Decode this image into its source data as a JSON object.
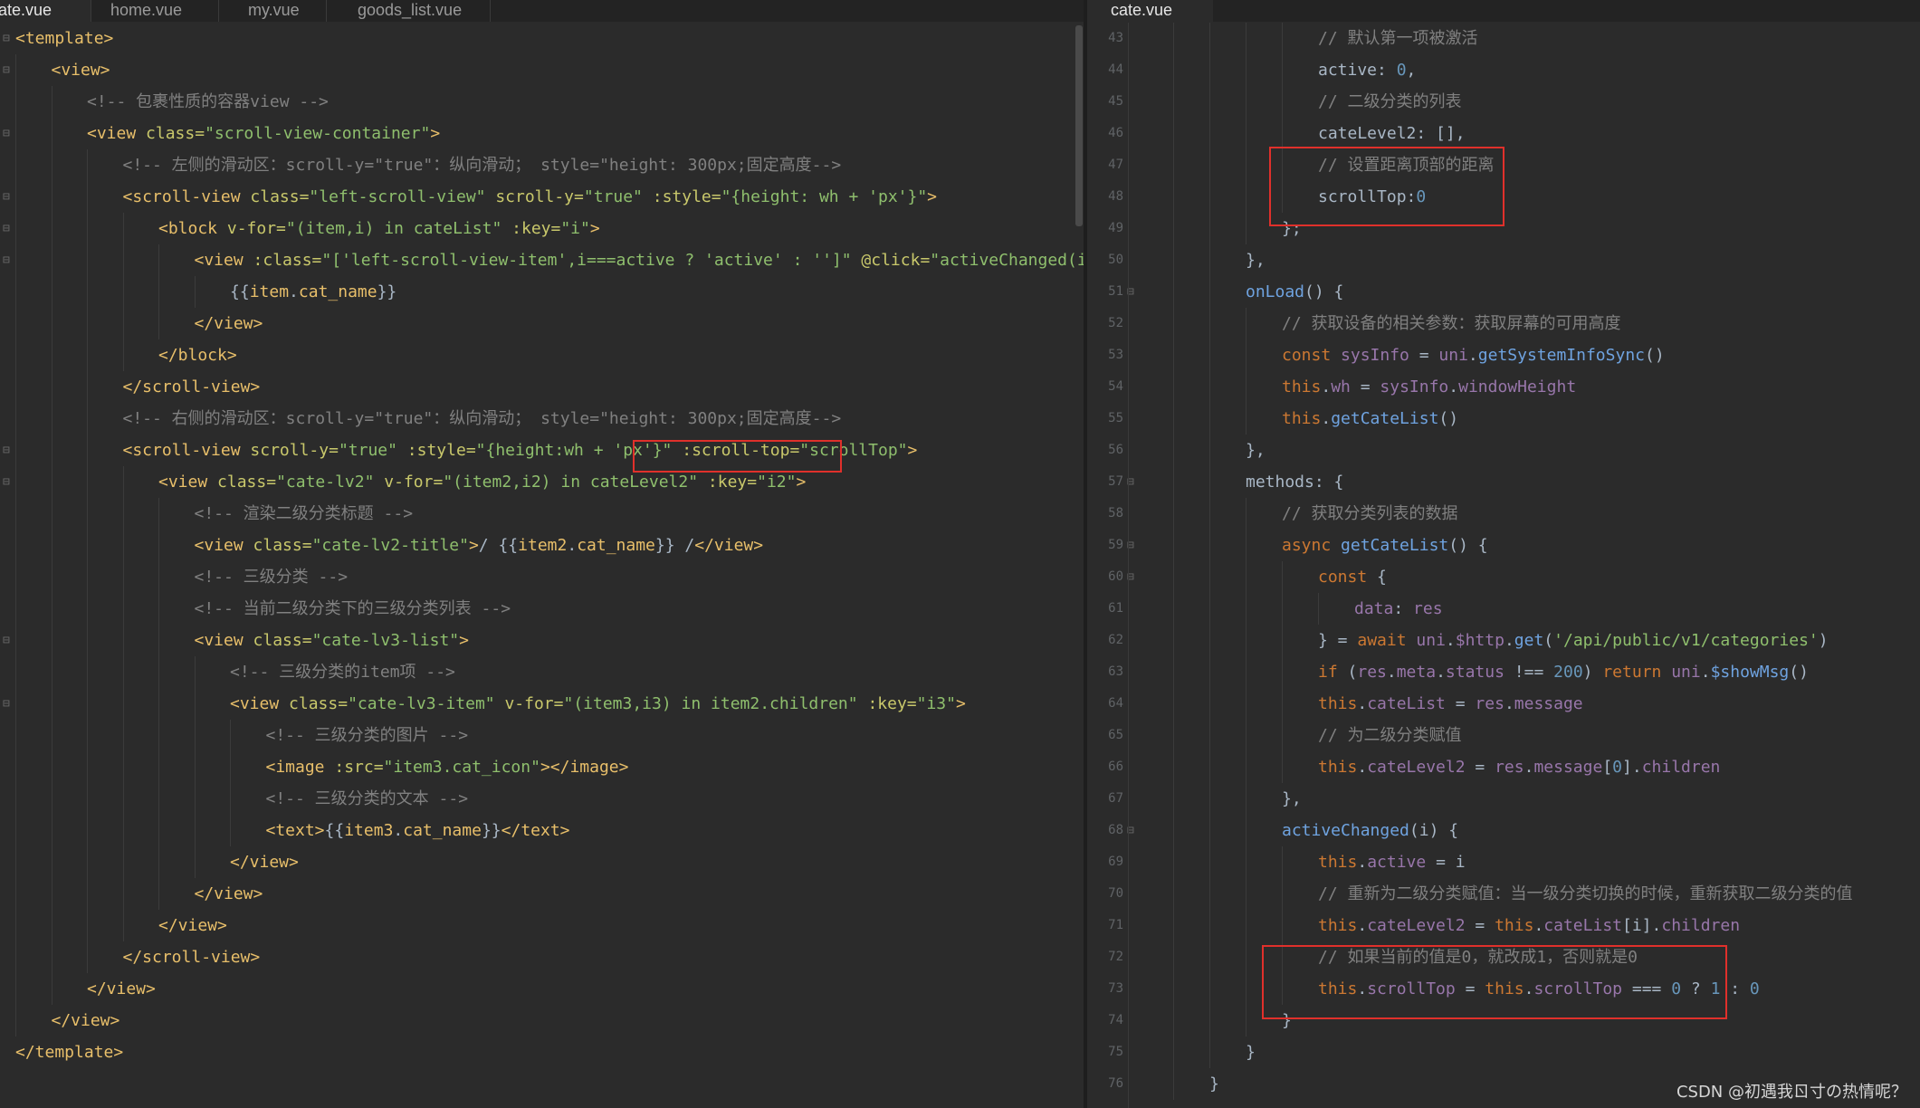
{
  "left_tabs": [
    "ate.vue",
    "home.vue",
    "my.vue",
    "goods_list.vue"
  ],
  "right_tabs": [
    "cate.vue"
  ],
  "watermark": "CSDN @初遇我ㄖ寸の热情呢？",
  "left_code": [
    [
      [
        "t-tag",
        "<template>"
      ]
    ],
    [
      [
        "t-tag",
        "<view>"
      ]
    ],
    [
      [
        "t-cmt",
        "<!-- 包裹性质的容器view -->"
      ]
    ],
    [
      [
        "t-tag",
        "<view "
      ],
      [
        "t-attr",
        "class="
      ],
      [
        "t-str",
        "\"scroll-view-container\""
      ],
      [
        "t-tag",
        ">"
      ]
    ],
    [
      [
        "t-cmt",
        "<!-- 左侧的滑动区：scroll-y=\"true\"：纵向滑动； style=\"height: 300px;固定高度-->"
      ]
    ],
    [
      [
        "t-tag",
        "<scroll-view "
      ],
      [
        "t-attr",
        "class="
      ],
      [
        "t-str",
        "\"left-scroll-view\" "
      ],
      [
        "t-attr",
        "scroll-y="
      ],
      [
        "t-str",
        "\"true\" "
      ],
      [
        "t-attr",
        ":style="
      ],
      [
        "t-str",
        "\"{height: wh + 'px'}\""
      ],
      [
        "t-tag",
        ">"
      ]
    ],
    [
      [
        "t-tag",
        "<block "
      ],
      [
        "t-attr",
        "v-for="
      ],
      [
        "t-str",
        "\"(item,i) in cateList\" "
      ],
      [
        "t-attr",
        ":key="
      ],
      [
        "t-str",
        "\"i\""
      ],
      [
        "t-tag",
        ">"
      ]
    ],
    [
      [
        "t-tag",
        "<view "
      ],
      [
        "t-attr",
        ":class="
      ],
      [
        "t-str",
        "\"['left-scroll-view-item',i===active ? 'active' : '']\" "
      ],
      [
        "t-attr",
        "@click="
      ],
      [
        "t-str",
        "\"activeChanged(i)\""
      ],
      [
        "t-tag",
        ">"
      ]
    ],
    [
      [
        "t-plain",
        "{{"
      ],
      [
        "t-tag",
        "item"
      ],
      [
        "t-plain",
        "."
      ],
      [
        "t-tag",
        "cat_name"
      ],
      [
        "t-plain",
        "}}"
      ]
    ],
    [
      [
        "t-tag",
        "</view>"
      ]
    ],
    [
      [
        "t-tag",
        "</block>"
      ]
    ],
    [
      [
        "t-tag",
        "</scroll-view>"
      ]
    ],
    [
      [
        "t-cmt",
        "<!-- 右侧的滑动区：scroll-y=\"true\"：纵向滑动； style=\"height: 300px;固定高度-->"
      ]
    ],
    [
      [
        "t-tag",
        "<scroll-view "
      ],
      [
        "t-attr",
        "scroll-y="
      ],
      [
        "t-str",
        "\"true\" "
      ],
      [
        "t-attr",
        ":style="
      ],
      [
        "t-str",
        "\"{height:wh + 'px'}\" "
      ],
      [
        "t-attr",
        ":scroll-top="
      ],
      [
        "t-str",
        "\"scrollTop\""
      ],
      [
        "t-tag",
        ">"
      ]
    ],
    [
      [
        "t-tag",
        "<view "
      ],
      [
        "t-attr",
        "class="
      ],
      [
        "t-str",
        "\"cate-lv2\" "
      ],
      [
        "t-attr",
        "v-for="
      ],
      [
        "t-str",
        "\"(item2,i2) in cateLevel2\" "
      ],
      [
        "t-attr",
        ":key="
      ],
      [
        "t-str",
        "\"i2\""
      ],
      [
        "t-tag",
        ">"
      ]
    ],
    [
      [
        "t-cmt",
        "<!-- 渲染二级分类标题 -->"
      ]
    ],
    [
      [
        "t-tag",
        "<view "
      ],
      [
        "t-attr",
        "class="
      ],
      [
        "t-str",
        "\"cate-lv2-title\""
      ],
      [
        "t-tag",
        ">"
      ],
      [
        "t-plain",
        "/ {{"
      ],
      [
        "t-tag",
        "item2"
      ],
      [
        "t-plain",
        "."
      ],
      [
        "t-tag",
        "cat_name"
      ],
      [
        "t-plain",
        "}} /"
      ],
      [
        "t-tag",
        "</view>"
      ]
    ],
    [
      [
        "t-cmt",
        "<!-- 三级分类 -->"
      ]
    ],
    [
      [
        "t-cmt",
        "<!-- 当前二级分类下的三级分类列表 -->"
      ]
    ],
    [
      [
        "t-tag",
        "<view "
      ],
      [
        "t-attr",
        "class="
      ],
      [
        "t-str",
        "\"cate-lv3-list\""
      ],
      [
        "t-tag",
        ">"
      ]
    ],
    [
      [
        "t-cmt",
        "<!-- 三级分类的item项 -->"
      ]
    ],
    [
      [
        "t-tag",
        "<view "
      ],
      [
        "t-attr",
        "class="
      ],
      [
        "t-str",
        "\"cate-lv3-item\" "
      ],
      [
        "t-attr",
        "v-for="
      ],
      [
        "t-str",
        "\"(item3,i3) in item2.children\" "
      ],
      [
        "t-attr",
        ":key="
      ],
      [
        "t-str",
        "\"i3\""
      ],
      [
        "t-tag",
        ">"
      ]
    ],
    [
      [
        "t-cmt",
        "<!-- 三级分类的图片 -->"
      ]
    ],
    [
      [
        "t-tag",
        "<image "
      ],
      [
        "t-attr",
        ":src="
      ],
      [
        "t-str",
        "\"item3.cat_icon\""
      ],
      [
        "t-tag",
        "></image>"
      ]
    ],
    [
      [
        "t-cmt",
        "<!-- 三级分类的文本 -->"
      ]
    ],
    [
      [
        "t-tag",
        "<text>"
      ],
      [
        "t-plain",
        "{{"
      ],
      [
        "t-tag",
        "item3"
      ],
      [
        "t-plain",
        "."
      ],
      [
        "t-tag",
        "cat_name"
      ],
      [
        "t-plain",
        "}}"
      ],
      [
        "t-tag",
        "</text>"
      ]
    ],
    [
      [
        "t-tag",
        "</view>"
      ]
    ],
    [
      [
        "t-tag",
        "</view>"
      ]
    ],
    [
      [
        "t-tag",
        "</view>"
      ]
    ],
    [
      [
        "t-tag",
        "</scroll-view>"
      ]
    ],
    [
      [
        "t-tag",
        "</view>"
      ]
    ],
    [
      [
        "t-tag",
        "</view>"
      ]
    ],
    [
      [
        "t-tag",
        "</template>"
      ]
    ]
  ],
  "left_fold": [
    true,
    true,
    false,
    true,
    false,
    true,
    true,
    true,
    false,
    false,
    false,
    false,
    false,
    true,
    true,
    false,
    false,
    false,
    false,
    true,
    false,
    true,
    false,
    false,
    false,
    false,
    false,
    false,
    false,
    false,
    false,
    false,
    false
  ],
  "right_code": [
    {
      "n": "43",
      "fold": false,
      "seg": [
        [
          "t-cmt",
          "// 默认第一项被激活"
        ]
      ]
    },
    {
      "n": "44",
      "fold": false,
      "seg": [
        [
          "t-plain",
          "active: "
        ],
        [
          "t-num",
          "0"
        ],
        [
          "t-plain",
          ","
        ]
      ]
    },
    {
      "n": "45",
      "fold": false,
      "seg": [
        [
          "t-cmt",
          "// 二级分类的列表"
        ]
      ]
    },
    {
      "n": "46",
      "fold": false,
      "seg": [
        [
          "t-plain",
          "cateLevel2: [],"
        ]
      ]
    },
    {
      "n": "47",
      "fold": false,
      "seg": [
        [
          "t-cmt",
          "// 设置距离顶部的距离"
        ]
      ]
    },
    {
      "n": "48",
      "fold": false,
      "seg": [
        [
          "t-plain",
          "scrollTop:"
        ],
        [
          "t-num",
          "0"
        ]
      ]
    },
    {
      "n": "49",
      "fold": false,
      "seg": [
        [
          "t-plain",
          "};"
        ]
      ]
    },
    {
      "n": "50",
      "fold": false,
      "seg": [
        [
          "t-plain",
          "},"
        ]
      ]
    },
    {
      "n": "51",
      "fold": true,
      "seg": [
        [
          "t-fn",
          "onLoad"
        ],
        [
          "t-plain",
          "() {"
        ]
      ]
    },
    {
      "n": "52",
      "fold": false,
      "seg": [
        [
          "t-cmt",
          "// 获取设备的相关参数：获取屏幕的可用高度"
        ]
      ]
    },
    {
      "n": "53",
      "fold": false,
      "seg": [
        [
          "t-kw",
          "const "
        ],
        [
          "t-prop",
          "sysInfo"
        ],
        [
          "t-plain",
          " = "
        ],
        [
          "t-prop",
          "uni"
        ],
        [
          "t-plain",
          "."
        ],
        [
          "t-fn",
          "getSystemInfoSync"
        ],
        [
          "t-plain",
          "()"
        ]
      ]
    },
    {
      "n": "54",
      "fold": false,
      "seg": [
        [
          "t-kw",
          "this"
        ],
        [
          "t-plain",
          "."
        ],
        [
          "t-prop",
          "wh"
        ],
        [
          "t-plain",
          " = "
        ],
        [
          "t-prop",
          "sysInfo"
        ],
        [
          "t-plain",
          "."
        ],
        [
          "t-prop",
          "windowHeight"
        ]
      ]
    },
    {
      "n": "55",
      "fold": false,
      "seg": [
        [
          "t-kw",
          "this"
        ],
        [
          "t-plain",
          "."
        ],
        [
          "t-fn",
          "getCateList"
        ],
        [
          "t-plain",
          "()"
        ]
      ]
    },
    {
      "n": "56",
      "fold": false,
      "seg": [
        [
          "t-plain",
          "},"
        ]
      ]
    },
    {
      "n": "57",
      "fold": true,
      "seg": [
        [
          "t-plain",
          "methods: {"
        ]
      ]
    },
    {
      "n": "58",
      "fold": false,
      "seg": [
        [
          "t-cmt",
          "// 获取分类列表的数据"
        ]
      ]
    },
    {
      "n": "59",
      "fold": true,
      "seg": [
        [
          "t-kw",
          "async "
        ],
        [
          "t-fn",
          "getCateList"
        ],
        [
          "t-plain",
          "() {"
        ]
      ]
    },
    {
      "n": "60",
      "fold": true,
      "seg": [
        [
          "t-kw",
          "const "
        ],
        [
          "t-plain",
          "{"
        ]
      ]
    },
    {
      "n": "61",
      "fold": false,
      "seg": [
        [
          "t-prop",
          "data"
        ],
        [
          "t-plain",
          ": "
        ],
        [
          "t-prop",
          "res"
        ]
      ]
    },
    {
      "n": "62",
      "fold": false,
      "seg": [
        [
          "t-plain",
          "} = "
        ],
        [
          "t-kw",
          "await "
        ],
        [
          "t-prop",
          "uni"
        ],
        [
          "t-plain",
          "."
        ],
        [
          "t-prop",
          "$http"
        ],
        [
          "t-plain",
          "."
        ],
        [
          "t-fn",
          "get"
        ],
        [
          "t-plain",
          "("
        ],
        [
          "t-str",
          "'/api/public/v1/categories'"
        ],
        [
          "t-plain",
          ")"
        ]
      ]
    },
    {
      "n": "63",
      "fold": false,
      "seg": [
        [
          "t-kw",
          "if "
        ],
        [
          "t-plain",
          "("
        ],
        [
          "t-prop",
          "res"
        ],
        [
          "t-plain",
          "."
        ],
        [
          "t-prop",
          "meta"
        ],
        [
          "t-plain",
          "."
        ],
        [
          "t-prop",
          "status"
        ],
        [
          "t-plain",
          " !== "
        ],
        [
          "t-num",
          "200"
        ],
        [
          "t-plain",
          ") "
        ],
        [
          "t-kw",
          "return "
        ],
        [
          "t-prop",
          "uni"
        ],
        [
          "t-plain",
          "."
        ],
        [
          "t-fn",
          "$showMsg"
        ],
        [
          "t-plain",
          "()"
        ]
      ]
    },
    {
      "n": "64",
      "fold": false,
      "seg": [
        [
          "t-kw",
          "this"
        ],
        [
          "t-plain",
          "."
        ],
        [
          "t-prop",
          "cateList"
        ],
        [
          "t-plain",
          " = "
        ],
        [
          "t-prop",
          "res"
        ],
        [
          "t-plain",
          "."
        ],
        [
          "t-prop",
          "message"
        ]
      ]
    },
    {
      "n": "65",
      "fold": false,
      "seg": [
        [
          "t-cmt",
          "// 为二级分类赋值"
        ]
      ]
    },
    {
      "n": "66",
      "fold": false,
      "seg": [
        [
          "t-kw",
          "this"
        ],
        [
          "t-plain",
          "."
        ],
        [
          "t-prop",
          "cateLevel2"
        ],
        [
          "t-plain",
          " = "
        ],
        [
          "t-prop",
          "res"
        ],
        [
          "t-plain",
          "."
        ],
        [
          "t-prop",
          "message"
        ],
        [
          "t-plain",
          "["
        ],
        [
          "t-num",
          "0"
        ],
        [
          "t-plain",
          "]."
        ],
        [
          "t-prop",
          "children"
        ]
      ]
    },
    {
      "n": "67",
      "fold": false,
      "seg": [
        [
          "t-plain",
          "},"
        ]
      ]
    },
    {
      "n": "68",
      "fold": true,
      "seg": [
        [
          "t-fn",
          "activeChanged"
        ],
        [
          "t-plain",
          "(i) {"
        ]
      ]
    },
    {
      "n": "69",
      "fold": false,
      "seg": [
        [
          "t-kw",
          "this"
        ],
        [
          "t-plain",
          "."
        ],
        [
          "t-prop",
          "active"
        ],
        [
          "t-plain",
          " = i"
        ]
      ]
    },
    {
      "n": "70",
      "fold": false,
      "seg": [
        [
          "t-cmt",
          "// 重新为二级分类赋值：当一级分类切换的时候，重新获取二级分类的值"
        ]
      ]
    },
    {
      "n": "71",
      "fold": false,
      "seg": [
        [
          "t-kw",
          "this"
        ],
        [
          "t-plain",
          "."
        ],
        [
          "t-prop",
          "cateLevel2"
        ],
        [
          "t-plain",
          " = "
        ],
        [
          "t-kw",
          "this"
        ],
        [
          "t-plain",
          "."
        ],
        [
          "t-prop",
          "cateList"
        ],
        [
          "t-plain",
          "[i]."
        ],
        [
          "t-prop",
          "children"
        ]
      ]
    },
    {
      "n": "72",
      "fold": false,
      "seg": [
        [
          "t-cmt",
          "// 如果当前的值是0，就改成1，否则就是0"
        ]
      ]
    },
    {
      "n": "73",
      "fold": false,
      "seg": [
        [
          "t-kw",
          "this"
        ],
        [
          "t-plain",
          "."
        ],
        [
          "t-prop",
          "scrollTop"
        ],
        [
          "t-plain",
          " = "
        ],
        [
          "t-kw",
          "this"
        ],
        [
          "t-plain",
          "."
        ],
        [
          "t-prop",
          "scrollTop"
        ],
        [
          "t-plain",
          " === "
        ],
        [
          "t-num",
          "0"
        ],
        [
          "t-plain",
          " ? "
        ],
        [
          "t-num",
          "1"
        ],
        [
          "t-plain",
          " : "
        ],
        [
          "t-num",
          "0"
        ]
      ]
    },
    {
      "n": "74",
      "fold": false,
      "seg": [
        [
          "t-plain",
          "}"
        ]
      ]
    },
    {
      "n": "75",
      "fold": false,
      "seg": [
        [
          "t-plain",
          "}"
        ]
      ]
    },
    {
      "n": "76",
      "fold": false,
      "seg": [
        [
          "t-plain",
          "}"
        ]
      ]
    }
  ]
}
